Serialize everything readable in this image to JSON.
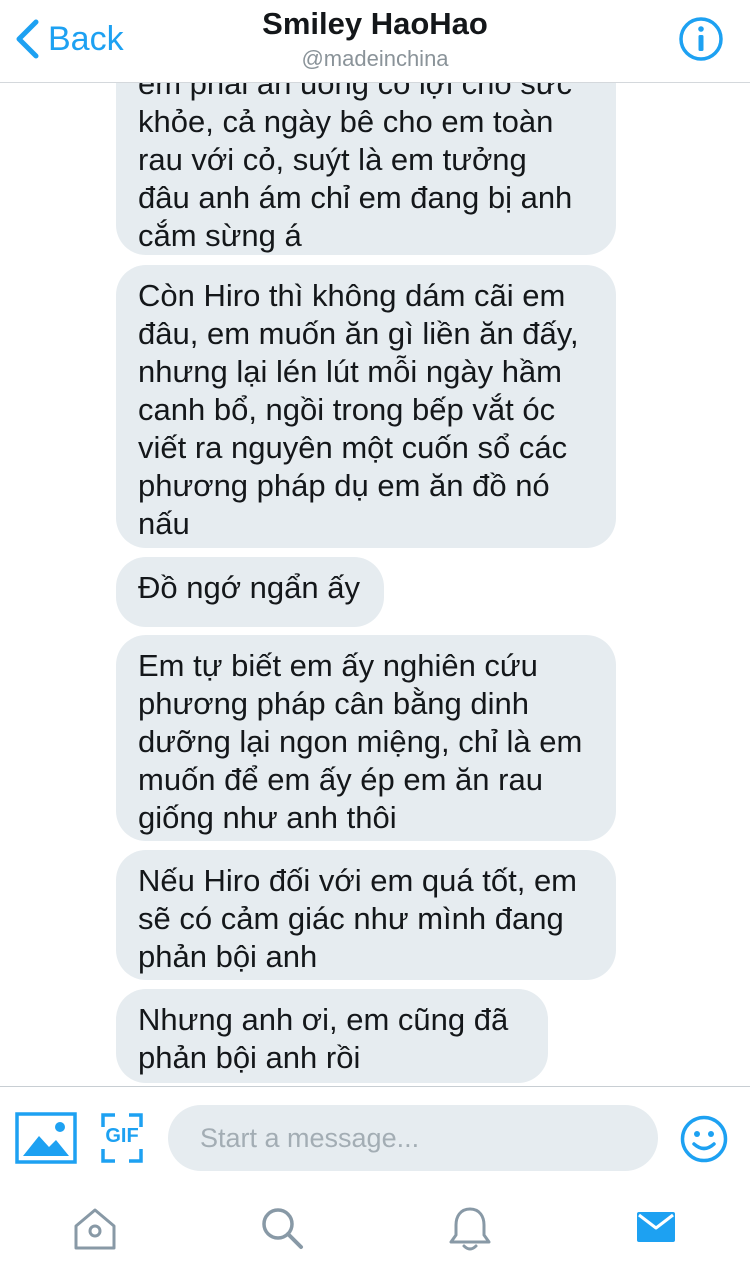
{
  "header": {
    "back_label": "Back",
    "title": "Smiley HaoHao",
    "handle": "@madeinchina",
    "accent": "#1da1f2"
  },
  "messages": [
    "em phải ăn uống có lợi cho sức\nkhỏe, cả ngày bê cho em toàn\nrau với cỏ, suýt là em tưởng\nđâu anh ám chỉ em đang bị anh\ncắm sừng á",
    "Còn Hiro thì không dám cãi em\nđâu, em muốn ăn gì liền ăn đấy,\nnhưng lại lén lút mỗi ngày hầm\ncanh bổ, ngồi trong bếp vắt óc\nviết ra nguyên một cuốn sổ các\nphương pháp dụ em ăn đồ nó\nnấu",
    "Đồ ngớ ngẩn ấy",
    "Em tự biết em ấy nghiên cứu\nphương pháp cân bằng dinh\ndưỡng lại ngon miệng, chỉ là em\nmuốn để em ấy ép em ăn rau\ngiống như anh thôi",
    "Nếu Hiro đối với em quá tốt, em\nsẽ có cảm giác như mình đang\nphản bội anh",
    "Nhưng anh ơi, em cũng đã\nphản bội anh rồi"
  ],
  "composer": {
    "placeholder": "Start a message...",
    "gif_label": "GIF",
    "icons": [
      "photo-icon",
      "gif-icon",
      "emoji-icon"
    ]
  },
  "tabbar": {
    "items": [
      "home-icon",
      "search-icon",
      "notifications-icon",
      "messages-icon"
    ],
    "active": "messages-icon",
    "inactive_color": "#8899a6",
    "active_color": "#1da1f2"
  },
  "bubble_color": "#e6ecf0"
}
